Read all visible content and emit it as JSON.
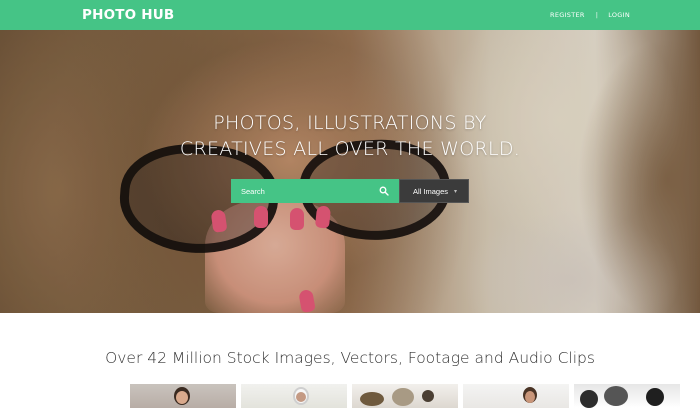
{
  "header": {
    "logo": "PHOTO HUB",
    "nav": {
      "register": "REGISTER",
      "separator": "|",
      "login": "LOGIN"
    }
  },
  "hero": {
    "title_line1": "PHOTOS, ILLUSTRATIONS BY",
    "title_line2": "CREATIVES ALL OVER THE WORLD.",
    "search": {
      "placeholder": "Search",
      "category": "All Images"
    }
  },
  "stats": {
    "heading": "Over 42 Million Stock Images, Vectors, Footage and Audio Clips"
  },
  "colors": {
    "accent": "#45c486",
    "dropdown_bg": "#3b3b3b",
    "heading_text": "#333333"
  },
  "icons": {
    "search": "search-icon",
    "dropdown": "chevron-down-icon"
  }
}
